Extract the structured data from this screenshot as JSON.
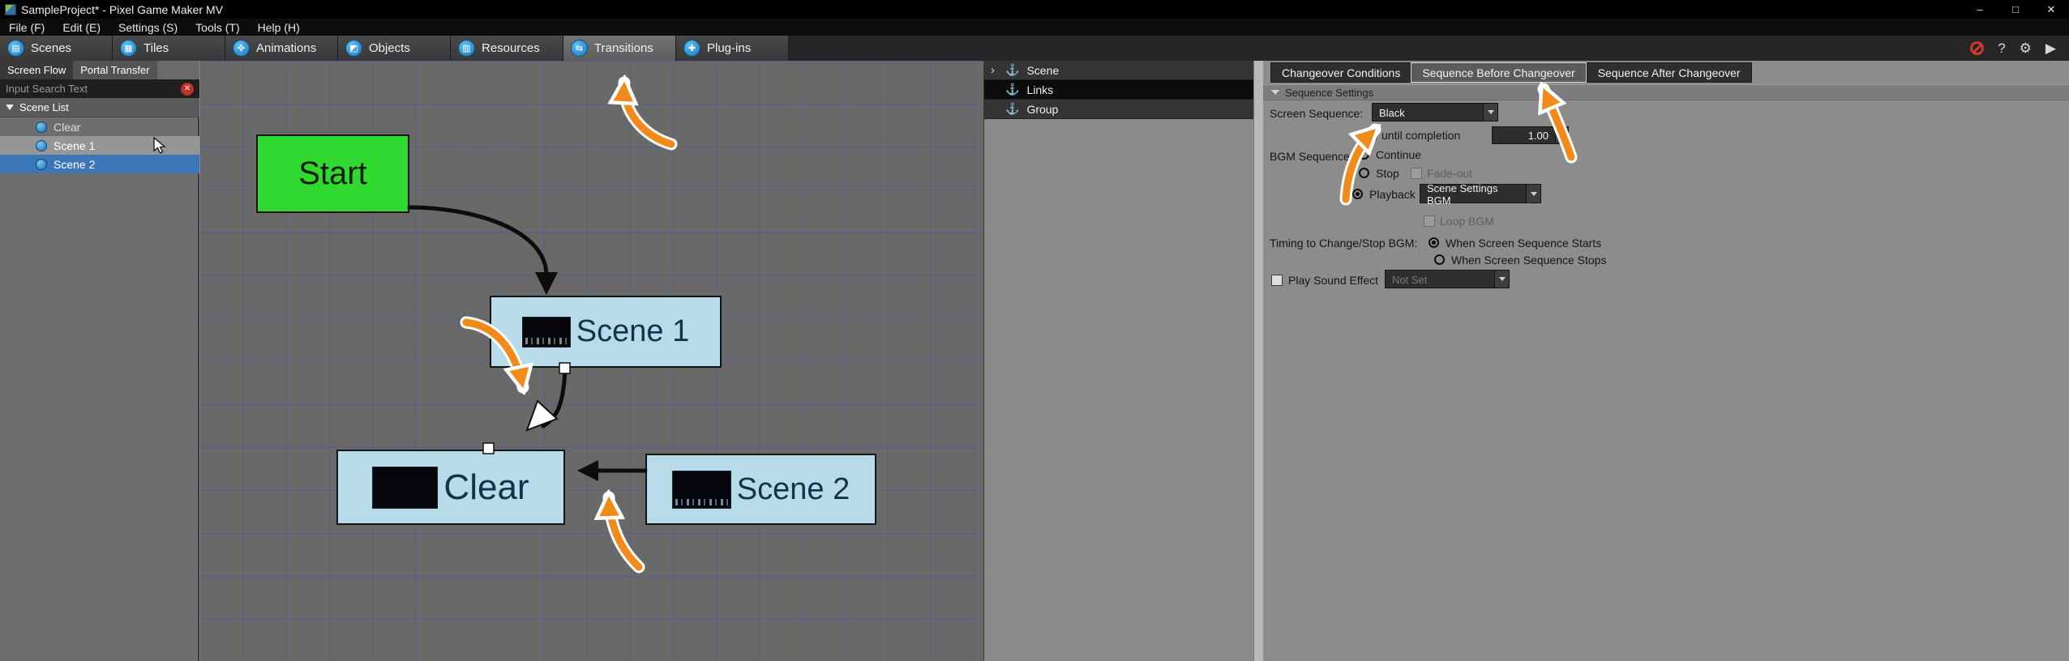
{
  "colors": {
    "selection_blue": "#3a76b8",
    "node_green": "#2fd92f",
    "node_blue": "#b7dbe9",
    "annotation_orange": "#f28a1a",
    "panel_gray": "#8c8c8c",
    "dark_input": "#2e2e2e"
  },
  "window": {
    "title": "SampleProject* - Pixel Game Maker MV",
    "minimize": "–",
    "maximize": "□",
    "close": "✕"
  },
  "menubar": {
    "items": [
      "File (F)",
      "Edit (E)",
      "Settings (S)",
      "Tools (T)",
      "Help (H)"
    ]
  },
  "toolbar": {
    "tabs": [
      {
        "label": "Scenes",
        "glyph": "▤",
        "selected": false
      },
      {
        "label": "Tiles",
        "glyph": "▦",
        "selected": false
      },
      {
        "label": "Animations",
        "glyph": "✜",
        "selected": false
      },
      {
        "label": "Objects",
        "glyph": "◩",
        "selected": false
      },
      {
        "label": "Resources",
        "glyph": "▥",
        "selected": false
      },
      {
        "label": "Transitions",
        "glyph": "⇆",
        "selected": true
      },
      {
        "label": "Plug-ins",
        "glyph": "✚",
        "selected": false
      }
    ],
    "help_icon": "?",
    "gear_icon": "⚙",
    "run_icon": "▶"
  },
  "left_panel": {
    "tabs": [
      {
        "label": "Screen Flow",
        "selected": true
      },
      {
        "label": "Portal Transfer",
        "selected": false
      }
    ],
    "search_placeholder": "Input Search Text",
    "clear_icon": "✕",
    "list_header": "Scene List",
    "items": [
      {
        "label": "Clear",
        "state": "normal"
      },
      {
        "label": "Scene 1",
        "state": "highlighted"
      },
      {
        "label": "Scene 2",
        "state": "selected"
      }
    ]
  },
  "canvas": {
    "nodes": [
      {
        "label": "Start",
        "type": "start"
      },
      {
        "label": "Scene 1",
        "type": "scene"
      },
      {
        "label": "Clear",
        "type": "clear"
      },
      {
        "label": "Scene 2",
        "type": "scene"
      }
    ]
  },
  "middle_panel": {
    "expander": "›",
    "icon": "⚓",
    "items": [
      {
        "label": "Scene",
        "expandable": true,
        "selected": false
      },
      {
        "label": "Links",
        "expandable": false,
        "selected": true
      },
      {
        "label": "Group",
        "expandable": false,
        "selected": false
      }
    ]
  },
  "right_panel": {
    "tabs": [
      {
        "label": "Changeover Conditions",
        "selected": false
      },
      {
        "label": "Sequence Before Changeover",
        "selected": true
      },
      {
        "label": "Sequence After Changeover",
        "selected": false
      }
    ],
    "section_header": "Sequence Settings",
    "screen_sequence_label": "Screen Sequence:",
    "screen_sequence_value": "Black",
    "until_completion_label": "until completion",
    "until_completion_value": "1.00",
    "until_completion_checked": true,
    "bgm_label": "BGM Sequence:",
    "bgm_continue": "Continue",
    "bgm_stop": "Stop",
    "bgm_fadeout": "Fade-out",
    "bgm_playback": "Playback",
    "bgm_dropdown_value": "Scene Settings BGM",
    "loop_bgm_label": "Loop BGM",
    "timing_label": "Timing to Change/Stop BGM:",
    "timing_start": "When Screen Sequence Starts",
    "timing_stop": "When Screen Sequence Stops",
    "play_se_label": "Play Sound Effect",
    "play_se_value": "Not Set"
  },
  "icons": {
    "check": "✓"
  }
}
